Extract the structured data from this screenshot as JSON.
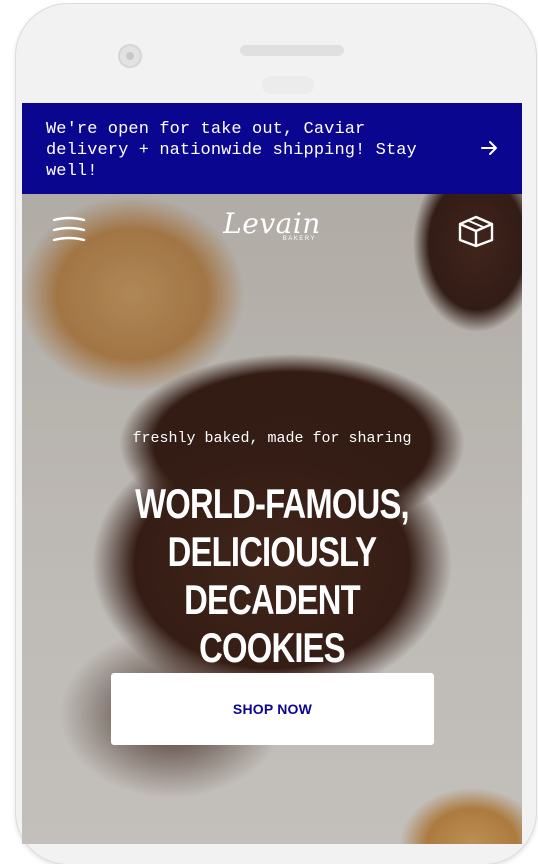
{
  "banner": {
    "text": "We're open for take out, Caviar\ndelivery + nationwide shipping! Stay\nwell!",
    "arrow_icon": "arrow-right-icon",
    "background": "#0b0690"
  },
  "header": {
    "menu_icon": "hamburger-menu-icon",
    "logo_name": "Levain",
    "logo_sub": "BAKERY",
    "box_icon": "shipping-box-icon"
  },
  "hero": {
    "tagline": "freshly baked, made for sharing",
    "headline": "WORLD-FAMOUS,\nDELICIOUSLY DECADENT\nCOOKIES",
    "cta_label": "SHOP NOW",
    "cta_color": "#0b0690"
  }
}
